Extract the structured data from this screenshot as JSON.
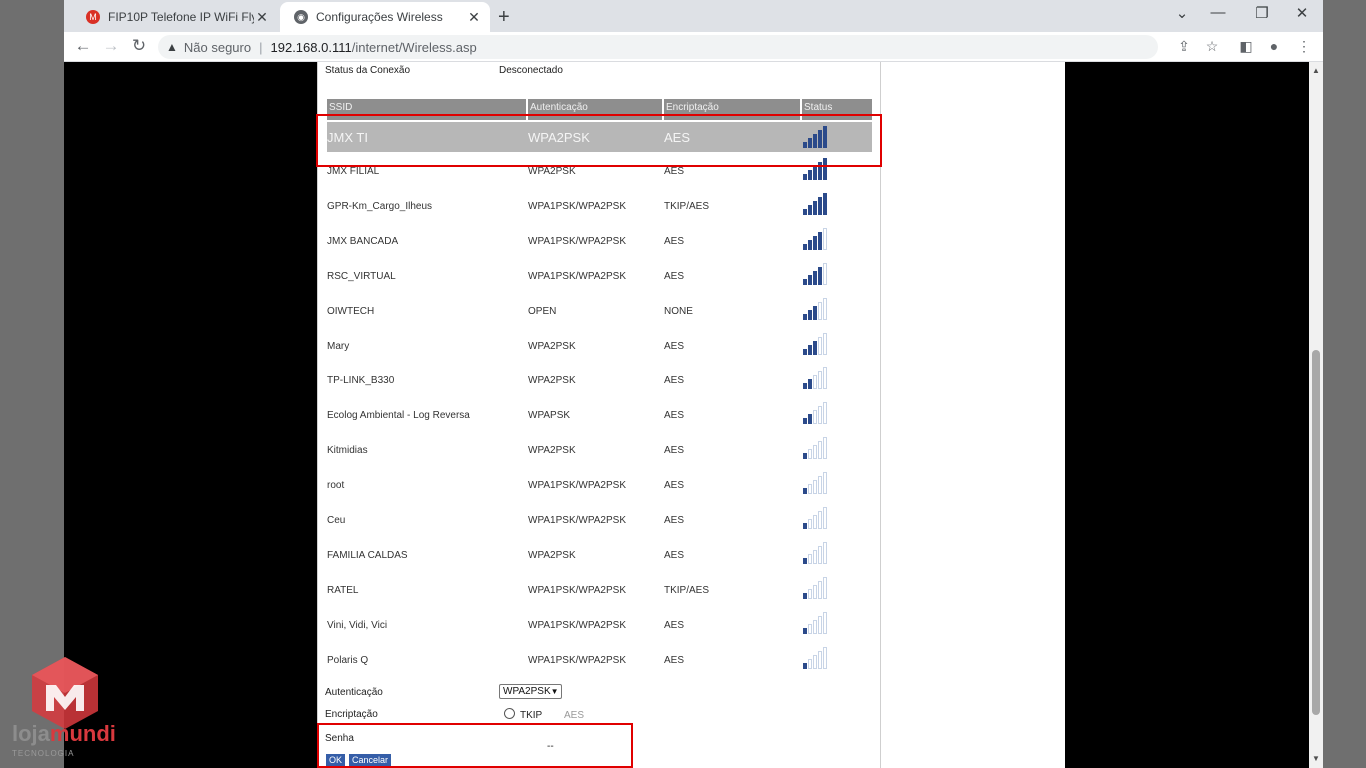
{
  "browser": {
    "tabs": [
      {
        "title": "FIP10P Telefone IP WiFi Flyingvoi",
        "icon": "gmail-icon",
        "color": "#d93025"
      },
      {
        "title": "Configurações Wireless",
        "icon": "globe-icon",
        "color": "#5f6368"
      }
    ],
    "omnibox": {
      "security": "Não seguro",
      "url_host": "192.168.0.111",
      "url_path": "/internet/Wireless.asp"
    }
  },
  "page": {
    "status_label": "Status da Conexão",
    "status_value": "Desconectado",
    "table": {
      "headers": [
        "SSID",
        "Autenticação",
        "Encriptação",
        "Status"
      ],
      "rows": [
        {
          "ssid": "JMX TI",
          "auth": "WPA2PSK",
          "enc": "AES",
          "signal": 5
        },
        {
          "ssid": "JMX FILIAL",
          "auth": "WPA2PSK",
          "enc": "AES",
          "signal": 5
        },
        {
          "ssid": "GPR-Km_Cargo_Ilheus",
          "auth": "WPA1PSK/WPA2PSK",
          "enc": "TKIP/AES",
          "signal": 5
        },
        {
          "ssid": "JMX BANCADA",
          "auth": "WPA1PSK/WPA2PSK",
          "enc": "AES",
          "signal": 4
        },
        {
          "ssid": "RSC_VIRTUAL",
          "auth": "WPA1PSK/WPA2PSK",
          "enc": "AES",
          "signal": 4
        },
        {
          "ssid": "OIWTECH",
          "auth": "OPEN",
          "enc": "NONE",
          "signal": 3
        },
        {
          "ssid": "Mary",
          "auth": "WPA2PSK",
          "enc": "AES",
          "signal": 3
        },
        {
          "ssid": "TP-LINK_B330",
          "auth": "WPA2PSK",
          "enc": "AES",
          "signal": 2
        },
        {
          "ssid": "Ecolog Ambiental - Log Reversa",
          "auth": "WPAPSK",
          "enc": "AES",
          "signal": 2
        },
        {
          "ssid": "Kitmidias",
          "auth": "WPA2PSK",
          "enc": "AES",
          "signal": 1
        },
        {
          "ssid": "root",
          "auth": "WPA1PSK/WPA2PSK",
          "enc": "AES",
          "signal": 1
        },
        {
          "ssid": "Ceu",
          "auth": "WPA1PSK/WPA2PSK",
          "enc": "AES",
          "signal": 1
        },
        {
          "ssid": "FAMILIA CALDAS",
          "auth": "WPA2PSK",
          "enc": "AES",
          "signal": 1
        },
        {
          "ssid": "RATEL",
          "auth": "WPA1PSK/WPA2PSK",
          "enc": "TKIP/AES",
          "signal": 1
        },
        {
          "ssid": "Vini, Vidi, Vici",
          "auth": "WPA1PSK/WPA2PSK",
          "enc": "AES",
          "signal": 1
        },
        {
          "ssid": "Polaris Q",
          "auth": "WPA1PSK/WPA2PSK",
          "enc": "AES",
          "signal": 1
        }
      ]
    },
    "form": {
      "auth_label": "Autenticação",
      "auth_value": "WPA2PSK",
      "enc_label": "Encriptação",
      "enc_tkip": "TKIP",
      "enc_aes": "AES",
      "password_label": "Senha",
      "password_value": "--",
      "ok_label": "OK",
      "cancel_label": "Cancelar"
    }
  },
  "watermark": {
    "brand_a": "loja",
    "brand_b": "mundi",
    "sub": "TECNOLOGIA"
  },
  "colors": {
    "highlight": "#e00000",
    "signal": "#2b4a8a",
    "button": "#355ea8"
  }
}
